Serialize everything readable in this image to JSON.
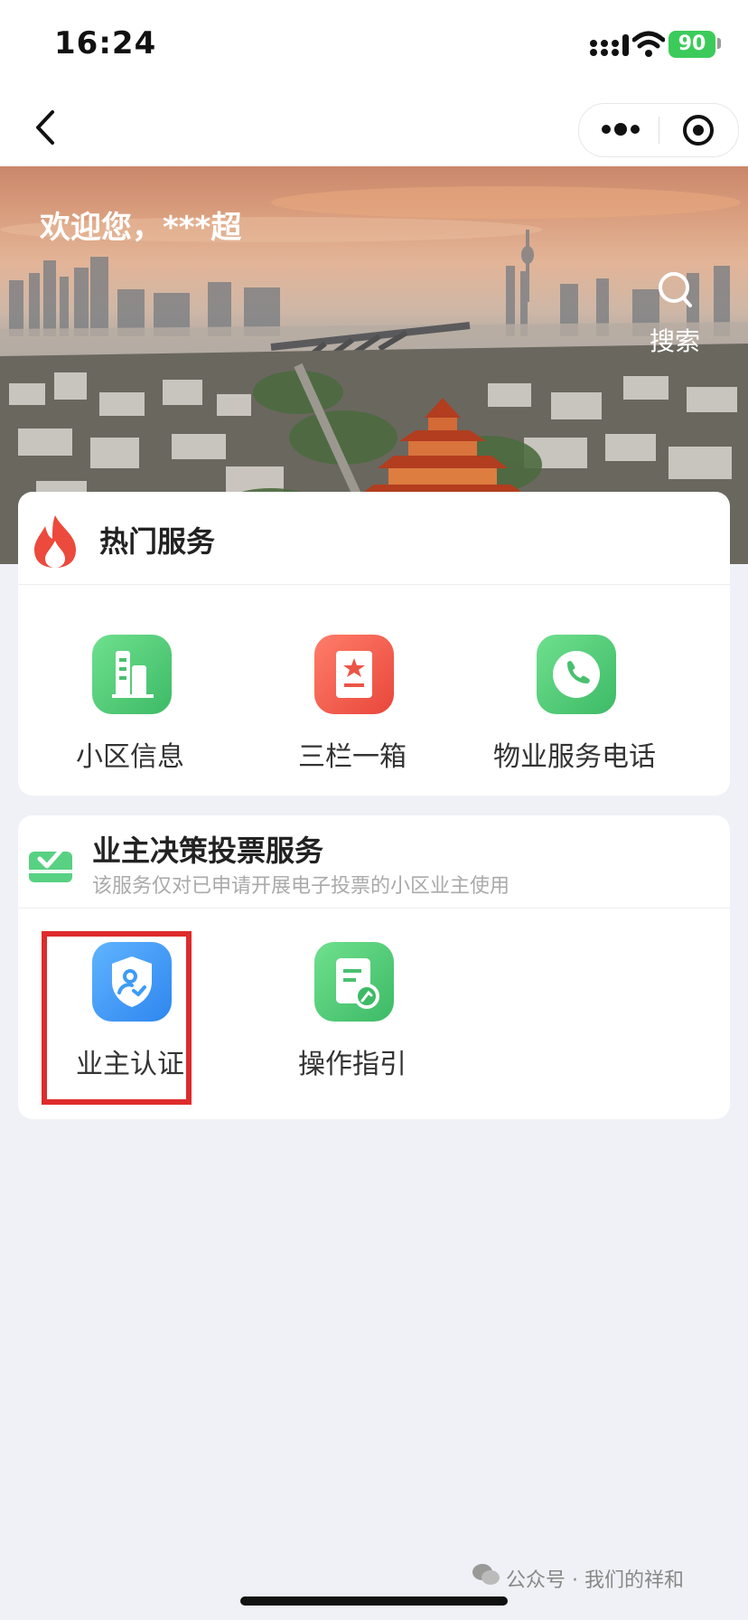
{
  "status_bar": {
    "time": "16:24",
    "battery": "90"
  },
  "banner": {
    "greeting": "欢迎您，***超",
    "search_label": "搜索"
  },
  "hot_services": {
    "title": "热门服务",
    "items": [
      {
        "label": "小区信息",
        "icon": "building-icon",
        "color": "#4fce79"
      },
      {
        "label": "三栏一箱",
        "icon": "notice-board-icon",
        "color": "#f0604f"
      },
      {
        "label": "物业服务电话",
        "icon": "phone-icon",
        "color": "#4fce79"
      }
    ]
  },
  "vote_services": {
    "title": "业主决策投票服务",
    "subtitle": "该服务仅对已申请开展电子投票的小区业主使用",
    "items": [
      {
        "label": "业主认证",
        "icon": "shield-user-icon",
        "color": "#3d9cf5"
      },
      {
        "label": "操作指引",
        "icon": "guide-doc-icon",
        "color": "#4fce79"
      }
    ]
  },
  "watermark": "公众号 · 我们的祥和",
  "colors": {
    "highlight": "#de2b2b",
    "accent_green": "#4fce79",
    "accent_red": "#f0604f",
    "accent_blue": "#3d9cf5"
  }
}
